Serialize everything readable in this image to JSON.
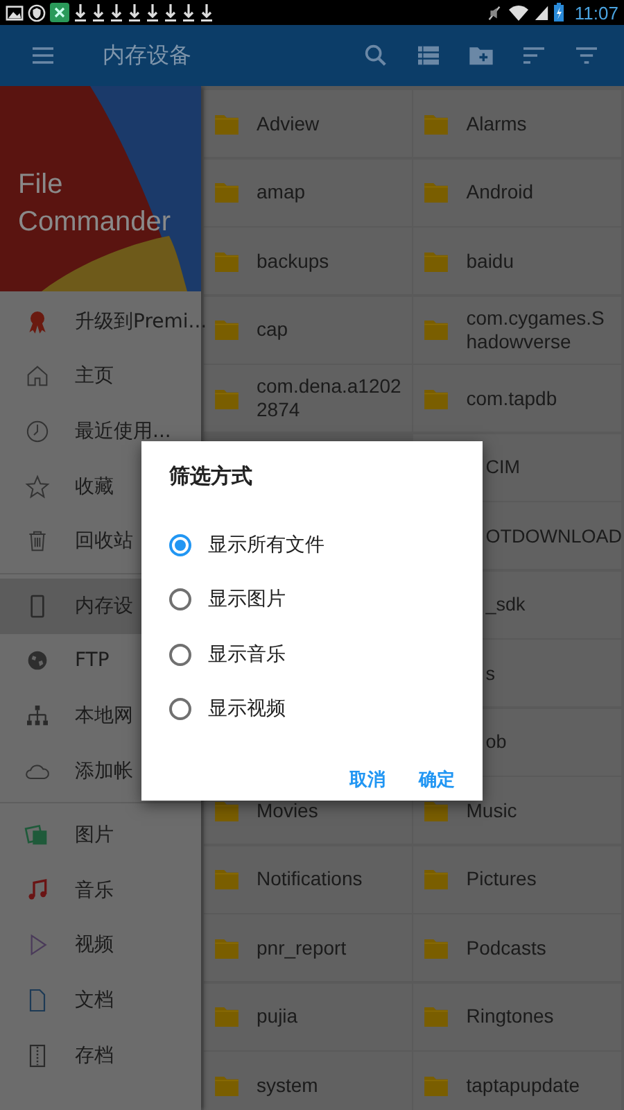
{
  "status_bar": {
    "time": "11:07"
  },
  "toolbar": {
    "title": "内存设备"
  },
  "drawer": {
    "header": {
      "title": "File Commander"
    },
    "sections": [
      {
        "items": [
          {
            "label": "升级到Premi...",
            "selected": false
          },
          {
            "label": "主页",
            "selected": false
          },
          {
            "label": "最近使用...",
            "selected": false
          },
          {
            "label": "收藏",
            "selected": false
          },
          {
            "label": "回收站",
            "selected": false
          }
        ]
      },
      {
        "items": [
          {
            "label": "内存设",
            "selected": true
          },
          {
            "label": "FTP",
            "selected": false
          },
          {
            "label": "本地网",
            "selected": false
          },
          {
            "label": "添加帐",
            "selected": false
          }
        ]
      },
      {
        "items": [
          {
            "label": "图片",
            "selected": false
          },
          {
            "label": "音乐",
            "selected": false
          },
          {
            "label": "视频",
            "selected": false
          },
          {
            "label": "文档",
            "selected": false
          },
          {
            "label": "存档",
            "selected": false
          }
        ]
      }
    ]
  },
  "folders": {
    "rows": [
      {
        "cells": [
          {
            "kind": "folder",
            "name": "Adview"
          },
          {
            "kind": "folder",
            "name": "Alarms"
          }
        ]
      },
      {
        "cells": [
          {
            "kind": "folder",
            "name": "amap"
          },
          {
            "kind": "folder",
            "name": "Android"
          }
        ]
      },
      {
        "cells": [
          {
            "kind": "folder",
            "name": "backups"
          },
          {
            "kind": "folder",
            "name": "baidu"
          }
        ]
      },
      {
        "cells": [
          {
            "kind": "folder",
            "name": "cap"
          },
          {
            "kind": "folder",
            "name": "com.cygames.Shadowverse"
          }
        ]
      },
      {
        "cells": [
          {
            "kind": "folder",
            "name": "com.dena.a12022874"
          },
          {
            "kind": "folder",
            "name": "com.tapdb"
          }
        ]
      },
      {
        "cells": [
          {
            "kind": "covered",
            "name": "CIM"
          }
        ]
      },
      {
        "cells": [
          {
            "kind": "covered",
            "name": "OTDOWNLOAD"
          }
        ]
      },
      {
        "cells": [
          {
            "kind": "covered",
            "name": "_sdk"
          }
        ]
      },
      {
        "cells": [
          {
            "kind": "covered",
            "name": "s"
          }
        ]
      },
      {
        "cells": [
          {
            "kind": "covered",
            "name": "ob"
          }
        ]
      },
      {
        "cells": [
          {
            "kind": "folder",
            "name": "Movies"
          },
          {
            "kind": "folder",
            "name": "Music"
          }
        ]
      },
      {
        "cells": [
          {
            "kind": "folder",
            "name": "Notifications"
          },
          {
            "kind": "folder",
            "name": "Pictures"
          }
        ]
      },
      {
        "cells": [
          {
            "kind": "folder",
            "name": "pnr_report"
          },
          {
            "kind": "folder",
            "name": "Podcasts"
          }
        ]
      },
      {
        "cells": [
          {
            "kind": "folder",
            "name": "pujia"
          },
          {
            "kind": "folder",
            "name": "Ringtones"
          }
        ]
      },
      {
        "cells": [
          {
            "kind": "folder",
            "name": "system"
          },
          {
            "kind": "folder",
            "name": "taptapupdate"
          }
        ]
      }
    ]
  },
  "dialog": {
    "title": "筛选方式",
    "options": [
      {
        "label": "显示所有文件",
        "selected": true
      },
      {
        "label": "显示图片",
        "selected": false
      },
      {
        "label": "显示音乐",
        "selected": false
      },
      {
        "label": "显示视频",
        "selected": false
      }
    ],
    "buttons": [
      "取消",
      "确定"
    ]
  }
}
